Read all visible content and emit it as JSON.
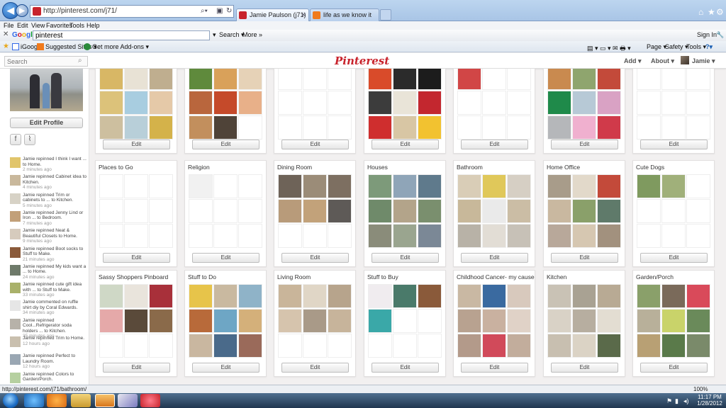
{
  "browser": {
    "address": "http://pinterest.com/j71/",
    "tabs": [
      {
        "label": "Jamie Paulson (j71) on Pint...",
        "active": true
      },
      {
        "label": "life as we know it",
        "active": false
      }
    ],
    "menu": [
      "File",
      "Edit",
      "View",
      "Favorites",
      "Tools",
      "Help"
    ],
    "google": {
      "logo": "Google",
      "query": "pinterest",
      "search_label": "Search ▾",
      "more_label": "More »",
      "signin": "Sign In"
    },
    "favorites": [
      {
        "label": "iGoogle",
        "icon": "igoogle-icon"
      },
      {
        "label": "Suggested Sites ▾",
        "icon": "suggested-sites-icon"
      },
      {
        "label": "Get more Add-ons ▾",
        "icon": "addons-icon"
      }
    ],
    "commands": [
      "Page ▾",
      "Safety ▾",
      "Tools ▾"
    ],
    "status_url": "http://pinterest.com/j71/bathroom/",
    "zoom": "100%"
  },
  "header": {
    "search_placeholder": "Search",
    "logo": "Pinterest",
    "add": "Add",
    "about": "About",
    "user": "Jamie"
  },
  "sidebar": {
    "edit_profile": "Edit Profile",
    "activity": [
      {
        "text": "Jamie repinned I think I want ... to Home.",
        "time": "2 minutes ago",
        "color": "#e1c56b"
      },
      {
        "text": "Jamie repinned Cabinet idea to Kitchen.",
        "time": "4 minutes ago",
        "color": "#c9b89c"
      },
      {
        "text": "Jamie repinned Trim or cabinets to ... to Kitchen.",
        "time": "5 minutes ago",
        "color": "#d7d2c6"
      },
      {
        "text": "Jamie repinned Jenny Lind or Iron ... to Bedroom.",
        "time": "7 minutes ago",
        "color": "#c2a079"
      },
      {
        "text": "Jamie repinned Neat & Beautiful Closets to Home.",
        "time": "9 minutes ago",
        "color": "#d6cbbd"
      },
      {
        "text": "Jamie repinned Boot socks to Stuff to Make.",
        "time": "21 minutes ago",
        "color": "#8a5a3a"
      },
      {
        "text": "Jamie repinned My kids want a ... to Home.",
        "time": "24 minutes ago",
        "color": "#6e7a6a"
      },
      {
        "text": "Jamie repinned cute gift idea with ... to Stuff to Make.",
        "time": "33 minutes ago",
        "color": "#a9b16a"
      },
      {
        "text": "Jamie commented on ruffle shirt diy by Coral Edwards.",
        "time": "34 minutes ago",
        "color": "#e6e6e6"
      },
      {
        "text": "Jamie repinned Cool...Refrigerator soda holders ... to Kitchen.",
        "time": "35 minutes ago",
        "color": "#b7b2a9"
      },
      {
        "text": "Jamie repinned Trim to Home.",
        "time": "12 hours ago",
        "color": "#c9bfae"
      },
      {
        "text": "Jamie repinned Perfect to Laundry Room.",
        "time": "12 hours ago",
        "color": "#9aa7b3"
      },
      {
        "text": "Jamie repinned Colors to Garden/Porch.",
        "time": "",
        "color": "#b6d0a0"
      }
    ]
  },
  "boards": {
    "edit_label": "Edit",
    "row1": [
      {
        "name": "",
        "colors": [
          "#d8b765",
          "#e8e2d5",
          "#bfae8f",
          "#dcc27a",
          "#a8cde0",
          "#e5c9a8",
          "#cdbf9f",
          "#b8cfd9",
          "#d4b24a"
        ]
      },
      {
        "name": "",
        "colors": [
          "#5f8a3c",
          "#d9a15a",
          "#e6d2b7",
          "#b9663d",
          "#c54a2a",
          "#e8b089",
          "#c28f5d",
          "#4f4338",
          "#ffffff"
        ]
      },
      {
        "name": "",
        "colors": [
          "#ffffff",
          "#ffffff",
          "#ffffff",
          "#ffffff",
          "#ffffff",
          "#ffffff",
          "#ffffff",
          "#ffffff",
          "#ffffff"
        ]
      },
      {
        "name": "",
        "colors": [
          "#d94b2a",
          "#2b2b2b",
          "#1c1c1c",
          "#3c3c3c",
          "#e9e4d8",
          "#c3272f",
          "#cf2e2e",
          "#d8c6a4",
          "#f2c230"
        ]
      },
      {
        "name": "",
        "colors": [
          "#d14646",
          "#ffffff",
          "#ffffff",
          "#ffffff",
          "#ffffff",
          "#ffffff",
          "#ffffff",
          "#ffffff",
          "#ffffff"
        ]
      },
      {
        "name": "",
        "colors": [
          "#c98a4f",
          "#8fa56e",
          "#c34a3a",
          "#1f8a4a",
          "#b7c9d6",
          "#d9a2c4",
          "#b5b7ba",
          "#f0b0cf",
          "#d03a4a"
        ]
      },
      {
        "name": "",
        "colors": [
          "#ffffff",
          "#ffffff",
          "#ffffff",
          "#ffffff",
          "#ffffff",
          "#ffffff",
          "#ffffff",
          "#ffffff",
          "#ffffff"
        ]
      }
    ],
    "row2": [
      {
        "name": "Places to Go",
        "colors": [
          "#ffffff",
          "#ffffff",
          "#ffffff",
          "#ffffff",
          "#ffffff",
          "#ffffff",
          "#ffffff",
          "#ffffff",
          "#ffffff"
        ]
      },
      {
        "name": "Religion",
        "colors": [
          "#f1f1f1",
          "#ffffff",
          "#ffffff",
          "#ffffff",
          "#ffffff",
          "#ffffff",
          "#ffffff",
          "#ffffff",
          "#ffffff"
        ]
      },
      {
        "name": "Dining Room",
        "colors": [
          "#6e6358",
          "#9b8c78",
          "#7d6f61",
          "#b89b7a",
          "#c2a27a",
          "#5e5a57",
          "#ffffff",
          "#ffffff",
          "#ffffff"
        ]
      },
      {
        "name": "Houses",
        "colors": [
          "#7d9a7a",
          "#8fa5b8",
          "#5f7a8c",
          "#6f8a6a",
          "#b3a48a",
          "#7a8f6e",
          "#8a8c7a",
          "#9aa58f",
          "#7b8896"
        ]
      },
      {
        "name": "Bathroom",
        "colors": [
          "#d9cdb7",
          "#e0c85a",
          "#d6cfc4",
          "#c8b89a",
          "#eaeaea",
          "#cbbda5",
          "#b8b2a7",
          "#e2ddd5",
          "#c7c1b7"
        ]
      },
      {
        "name": "Home Office",
        "colors": [
          "#a89c8a",
          "#e2d9ca",
          "#c34a3a",
          "#c9b8a0",
          "#8aa06a",
          "#5f7a6a",
          "#b8a89a",
          "#d6c7b1",
          "#a2917e"
        ]
      },
      {
        "name": "Cute Dogs",
        "colors": [
          "#7f9a5f",
          "#a0b07a",
          "#ffffff",
          "#ffffff",
          "#ffffff",
          "#ffffff",
          "#ffffff",
          "#ffffff",
          "#ffffff"
        ]
      }
    ],
    "row3": [
      {
        "name": "Sassy Shoppers Pinboard",
        "colors": [
          "#cfd8c6",
          "#e9e4dc",
          "#a8303a",
          "#e5a9a9",
          "#5a4a3a",
          "#8a6a4a",
          "#ffffff",
          "#ffffff",
          "#ffffff"
        ]
      },
      {
        "name": "Stuff to Do",
        "colors": [
          "#e7c44a",
          "#c9b9a0",
          "#8fb3c8",
          "#b86a3a",
          "#6ea6c5",
          "#d4b07a",
          "#c9b7a0",
          "#4a6a8a",
          "#9a6a5a"
        ]
      },
      {
        "name": "Living Room",
        "colors": [
          "#c9b59a",
          "#e0d6c6",
          "#b7a48c",
          "#d6c4ad",
          "#a99a88",
          "#c7b49b",
          "#ffffff",
          "#ffffff",
          "#ffffff"
        ]
      },
      {
        "name": "Stuff to Buy",
        "colors": [
          "#f0ecef",
          "#4a7a6a",
          "#8a5a3a",
          "#3aa8a8",
          "#ffffff",
          "#ffffff",
          "#ffffff",
          "#ffffff",
          "#ffffff"
        ]
      },
      {
        "name": "Childhood Cancer- my cause",
        "colors": [
          "#c9b8a3",
          "#3a6aa0",
          "#d8c9bd",
          "#b8a290",
          "#c9b1a0",
          "#e0d2c7",
          "#b39a8a",
          "#d14a5a",
          "#c2ad9c"
        ]
      },
      {
        "name": "Kitchen",
        "colors": [
          "#c9c2b5",
          "#a9a293",
          "#b8aa94",
          "#d9d2c6",
          "#b7aea0",
          "#e3ddd2",
          "#c8bfb0",
          "#dbd3c5",
          "#5a6a4a"
        ]
      },
      {
        "name": "Garden/Porch",
        "colors": [
          "#8aa06a",
          "#7a6a5a",
          "#d94a5a",
          "#b8b09a",
          "#c9d36a",
          "#6a8a5a",
          "#b8a074",
          "#5a7a4a",
          "#7a8a6a"
        ]
      }
    ]
  },
  "taskbar": {
    "time": "11:17 PM",
    "date": "1/28/2012"
  }
}
